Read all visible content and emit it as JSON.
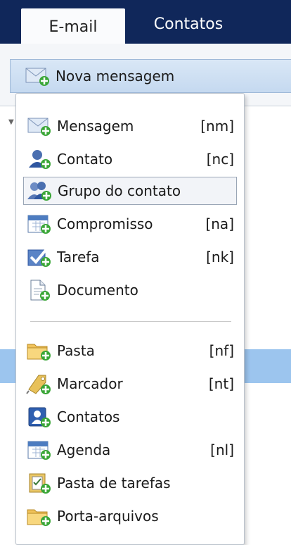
{
  "tabs": [
    {
      "label": "E-mail",
      "active": true
    },
    {
      "label": "Contatos",
      "active": false
    }
  ],
  "new_button": {
    "label": "Nova mensagem",
    "icon": "envelope-plus-icon"
  },
  "menu": {
    "group1": [
      {
        "label": "Mensagem",
        "shortcut": "[nm]",
        "icon": "envelope-icon"
      },
      {
        "label": "Contato",
        "shortcut": "[nc]",
        "icon": "contact-icon"
      },
      {
        "label": "Grupo do contato",
        "shortcut": "",
        "icon": "contact-group-icon",
        "highlighted": true
      },
      {
        "label": "Compromisso",
        "shortcut": "[na]",
        "icon": "calendar-icon"
      },
      {
        "label": "Tarefa",
        "shortcut": "[nk]",
        "icon": "task-check-icon"
      },
      {
        "label": "Documento",
        "shortcut": "",
        "icon": "document-icon"
      }
    ],
    "group2": [
      {
        "label": "Pasta",
        "shortcut": "[nf]",
        "icon": "folder-icon"
      },
      {
        "label": "Marcador",
        "shortcut": "[nt]",
        "icon": "tag-icon"
      },
      {
        "label": "Contatos",
        "shortcut": "",
        "icon": "address-book-icon"
      },
      {
        "label": "Agenda",
        "shortcut": "[nl]",
        "icon": "calendar-icon"
      },
      {
        "label": "Pasta de tarefas",
        "shortcut": "",
        "icon": "task-folder-icon"
      },
      {
        "label": "Porta-arquivos",
        "shortcut": "",
        "icon": "briefcase-folder-icon"
      }
    ]
  },
  "colors": {
    "header_bg": "#10275a",
    "button_bg": "#c5d9f0",
    "selection_bg": "#9cc5ee",
    "plus_green": "#3aa637"
  }
}
